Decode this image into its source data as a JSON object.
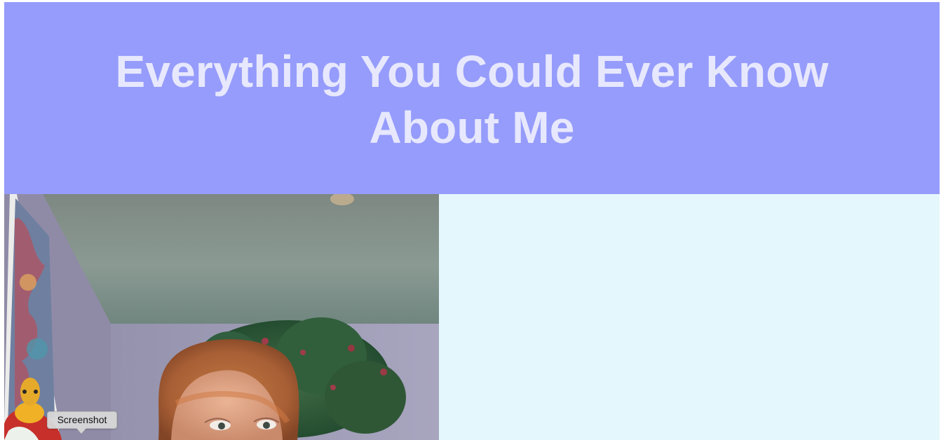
{
  "page": {
    "title": "Everything You Could Ever Know About Me",
    "tooltip": "Screenshot",
    "colors": {
      "header_background": "#969cfb",
      "title_text": "#e7e8fd",
      "content_background": "#e4f7fd"
    }
  },
  "image": {
    "alt": ""
  },
  "icons": {
    "tooltip_caret": "tooltip-caret-icon"
  }
}
